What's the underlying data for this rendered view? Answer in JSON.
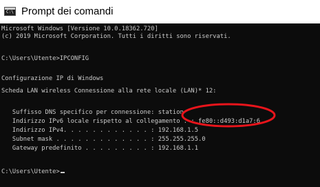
{
  "window": {
    "title": "Prompt dei comandi",
    "icon_label": "C:\\"
  },
  "console": {
    "lines": [
      "Microsoft Windows [Versione 10.0.18362.720]",
      "(c) 2019 Microsoft Corporation. Tutti i diritti sono riservati.",
      "",
      "C:\\Users\\Utente>IPCONFIG",
      "",
      "Configurazione IP di Windows",
      "",
      "Scheda LAN wireless Connessione alla rete locale (LAN)* 12:",
      "",
      "   Suffisso DNS specifico per connessione: station",
      "   Indirizzo IPv6 locale rispetto al collegamento . : fe80::d493:d1a7:6",
      "   Indirizzo IPv4. . . . . . . . . . . . : 192.168.1.5",
      "   Subnet mask . . . . . . . . . . . . . : 255.255.255.0",
      "   Gateway predefinito . . . . . . . . . : 192.168.1.1",
      "",
      "C:\\Users\\Utente>"
    ]
  },
  "colors": {
    "console_background": "#0c0c0c",
    "console_text": "#cccccc",
    "annotation": "#e8141b"
  }
}
